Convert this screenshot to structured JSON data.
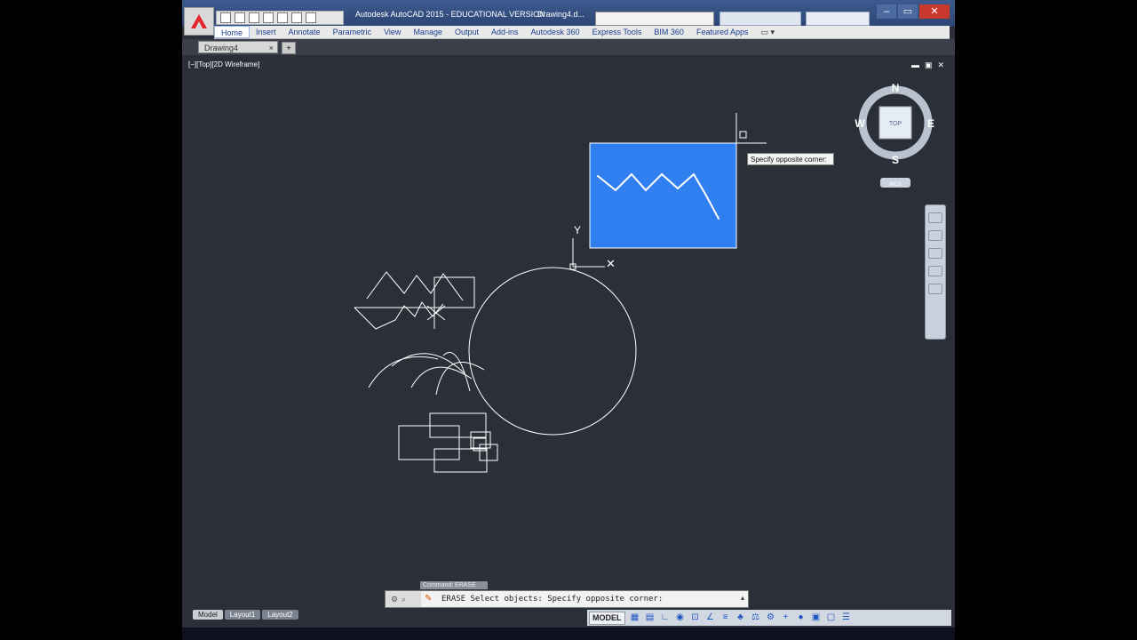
{
  "app": {
    "title": "Autodesk AutoCAD 2015 - EDUCATIONAL VERSION",
    "file_title": "Drawing4.d..."
  },
  "ribbon": {
    "tabs": [
      "Home",
      "Insert",
      "Annotate",
      "Parametric",
      "View",
      "Manage",
      "Output",
      "Add-ins",
      "Autodesk 360",
      "Express Tools",
      "BIM 360",
      "Featured Apps"
    ],
    "active_tab": "Home",
    "more": "▭ ▾"
  },
  "document_tab": {
    "label": "Drawing4",
    "close": "×",
    "new": "+"
  },
  "viewport": {
    "label": "[−][Top][2D Wireframe]",
    "controls": [
      "▬",
      "▣",
      "✕"
    ]
  },
  "viewcube": {
    "face": "TOP",
    "north": "N",
    "south": "S",
    "east": "E",
    "west": "W",
    "wcs": "WCS"
  },
  "ucs": {
    "y_label": "Y",
    "x_label": "✕"
  },
  "tooltip": {
    "text": "Specify opposite corner:"
  },
  "command": {
    "history_label": "Command:  ERASE",
    "line": "ERASE Select objects: Specify opposite corner:",
    "up_arrow": "▴"
  },
  "layouts": [
    "Model",
    "Layout1",
    "Layout2"
  ],
  "status": {
    "model": "MODEL"
  },
  "colors": {
    "canvas": "#2b2f38",
    "selection_window": "#2f7ff0",
    "drawing_lines": "#ffffff"
  }
}
